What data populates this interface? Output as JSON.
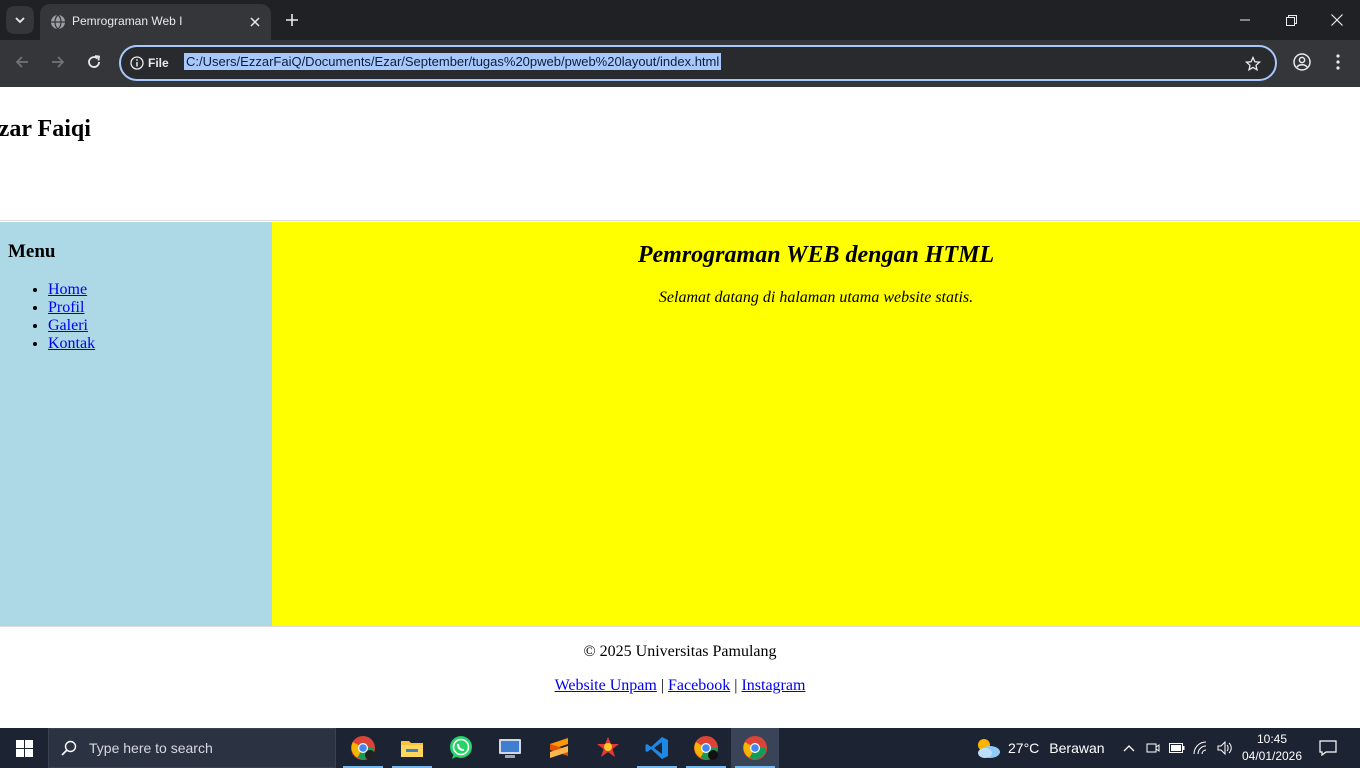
{
  "browser": {
    "tab_title": "Pemrograman Web I",
    "site_info_label": "File",
    "url": "C:/Users/EzzarFaiQ/Documents/Ezar/September/tugas%20pweb/pweb%20layout/index.html"
  },
  "page": {
    "header_title": "Ezzar Faiqi",
    "sidebar": {
      "heading": "Menu",
      "items": [
        {
          "label": "Home"
        },
        {
          "label": "Profil"
        },
        {
          "label": "Galeri"
        },
        {
          "label": "Kontak"
        }
      ]
    },
    "main": {
      "title": "Pemrograman WEB dengan HTML",
      "subtitle": "Selamat datang di halaman utama website statis."
    },
    "footer": {
      "copyright": "© 2025 Universitas Pamulang",
      "links": [
        {
          "label": "Website Unpam"
        },
        {
          "label": "Facebook"
        },
        {
          "label": "Instagram"
        }
      ],
      "separator": "|"
    },
    "colors": {
      "sidebar_bg": "#add8e6",
      "main_bg": "#ffff00",
      "link": "#0000ee"
    }
  },
  "taskbar": {
    "search_placeholder": "Type here to search",
    "weather_temp": "27°C",
    "weather_desc": "Berawan",
    "time": "10:45",
    "date": "04/01/2026",
    "apps": [
      "chrome-profile-icon",
      "file-explorer-icon",
      "whatsapp-icon",
      "remote-desktop-icon",
      "sublime-text-icon",
      "game-icon",
      "vscode-icon",
      "chrome-profile-icon",
      "chrome-icon"
    ]
  }
}
